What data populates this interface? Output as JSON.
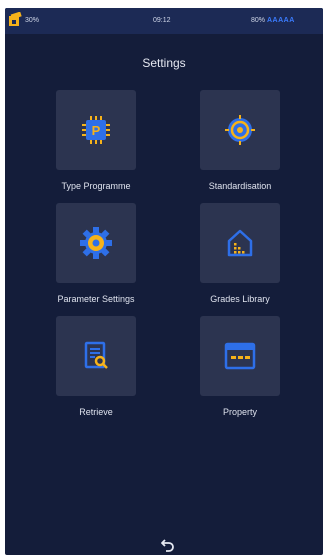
{
  "status": {
    "left_percent": "30%",
    "time": "09:12",
    "right_percent": "80%",
    "accent_text": "AAAAA"
  },
  "page": {
    "title": "Settings"
  },
  "tiles": [
    {
      "label": "Type Programme",
      "icon": "chip-icon"
    },
    {
      "label": "Standardisation",
      "icon": "target-icon"
    },
    {
      "label": "Parameter Settings",
      "icon": "gear-icon"
    },
    {
      "label": "Grades Library",
      "icon": "home-library-icon"
    },
    {
      "label": "Retrieve",
      "icon": "document-search-icon"
    },
    {
      "label": "Property",
      "icon": "window-icon"
    }
  ],
  "colors": {
    "background": "#141d3a",
    "statusbar": "#1c2a55",
    "tile": "#2c3450",
    "icon_accent": "#f6b21a",
    "icon_blue": "#2e6fe8"
  }
}
